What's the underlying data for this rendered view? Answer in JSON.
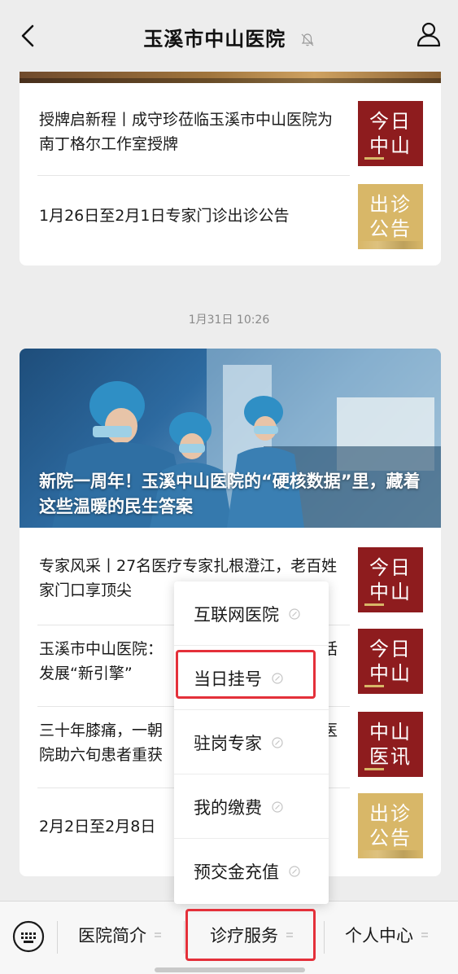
{
  "nav": {
    "title": "玉溪市中山医院",
    "back_icon": "chevron-left-icon",
    "mute_icon": "bell-off-icon",
    "profile_icon": "user-icon"
  },
  "feed": {
    "card1": {
      "items": [
        {
          "title": "授牌启新程丨成守珍莅临玉溪市中山医院为南丁格尔工作室授牌",
          "thumb": "今日中山",
          "thumb_style": "red"
        },
        {
          "title": "1月26日至2月1日专家门诊出诊公告",
          "thumb": "出诊公告",
          "thumb_style": "gold"
        }
      ]
    },
    "timestamp": "1月31日 10:26",
    "card2": {
      "hero_title": "新院一周年！玉溪中山医院的“硬核数据”里，藏着这些温暖的民生答案",
      "items": [
        {
          "title": "专家风采丨27名医疗专家扎根澄江，老百姓家门口享顶尖",
          "thumb": "今日中山",
          "thumb_style": "red"
        },
        {
          "title": "玉溪市中山医院：",
          "title_tail": "话",
          "title2": "发展“新引擎”",
          "thumb": "今日中山",
          "thumb_style": "red"
        },
        {
          "title": "三十年膝痛，一朝",
          "title_tail": "医",
          "title2": "院助六旬患者重获",
          "thumb": "中山医讯",
          "thumb_style": "red"
        },
        {
          "title": "2月2日至2月8日",
          "thumb": "出诊公告",
          "thumb_style": "gold"
        }
      ]
    }
  },
  "popup_menu": {
    "items": [
      {
        "label": "互联网医院",
        "icon": "link-icon"
      },
      {
        "label": "当日挂号",
        "icon": "link-icon",
        "highlighted": true
      },
      {
        "label": "驻岗专家",
        "icon": "link-icon"
      },
      {
        "label": "我的缴费",
        "icon": "link-icon"
      },
      {
        "label": "预交金充值",
        "icon": "link-icon"
      }
    ]
  },
  "bottom_menu": {
    "keyboard_icon": "keyboard-icon",
    "tabs": [
      {
        "label": "医院简介",
        "icon": "menu-lines-icon"
      },
      {
        "label": "诊疗服务",
        "icon": "menu-lines-icon",
        "highlighted": true
      },
      {
        "label": "个人中心",
        "icon": "menu-lines-icon"
      }
    ]
  },
  "colors": {
    "accent_red": "#8e1c1e",
    "accent_gold": "#d8b768",
    "highlight_border": "#e4303a",
    "background": "#ededed"
  }
}
